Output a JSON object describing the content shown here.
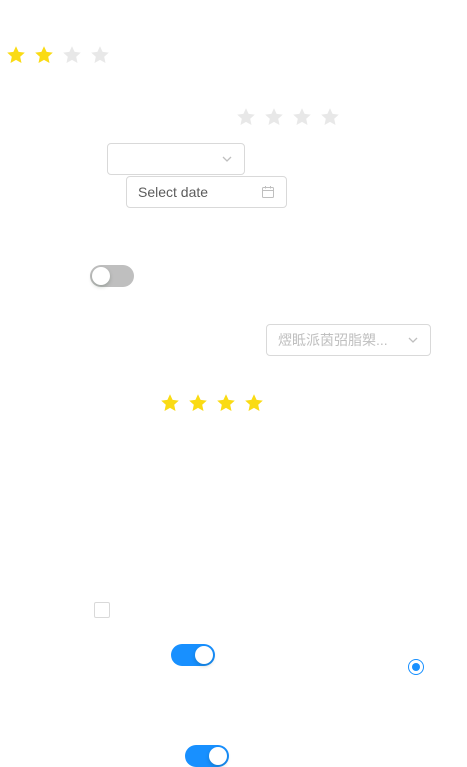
{
  "colors": {
    "star_on": "#fadb14",
    "star_off": "#e8e8e8",
    "switch_on": "#1890ff",
    "switch_off": "#bfbfbf",
    "border": "#d9d9d9",
    "radio": "#1890ff"
  },
  "rate_1": {
    "value": 2,
    "max": 4
  },
  "rate_2": {
    "value": 0,
    "max": 4
  },
  "rate_3": {
    "value": 4,
    "max": 4
  },
  "select_1": {
    "value": "",
    "icon": "chevron-down-icon"
  },
  "date_picker": {
    "placeholder": "Select date",
    "icon": "calendar-icon"
  },
  "switch_1": {
    "checked": false
  },
  "select_2": {
    "value": "熤眡派茵弨脂槊...",
    "icon": "chevron-down-icon"
  },
  "checkbox_1": {
    "checked": false
  },
  "switch_2": {
    "checked": true
  },
  "radio_1": {
    "checked": true
  },
  "switch_3": {
    "checked": true
  }
}
